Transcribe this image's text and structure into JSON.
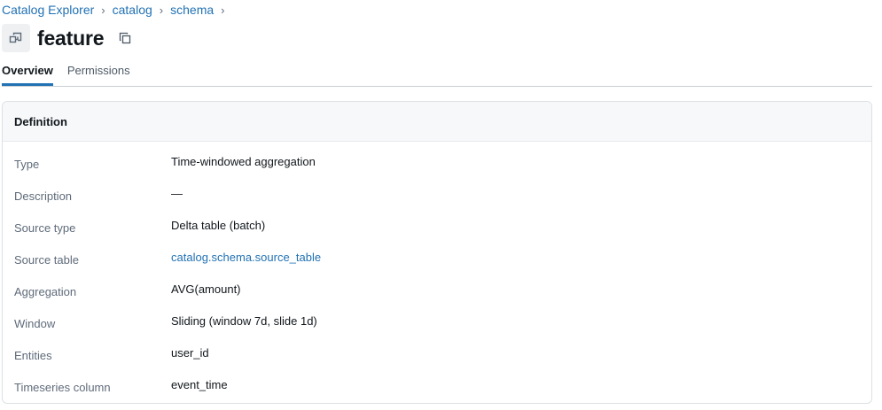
{
  "breadcrumb": {
    "items": [
      "Catalog Explorer",
      "catalog",
      "schema"
    ],
    "separator": "›"
  },
  "header": {
    "title": "feature",
    "icon": "feature-object-icon",
    "copy_icon": "copy-icon"
  },
  "tabs": [
    {
      "label": "Overview",
      "active": true
    },
    {
      "label": "Permissions",
      "active": false
    }
  ],
  "definition": {
    "title": "Definition",
    "rows": [
      {
        "label": "Type",
        "value": "Time-windowed aggregation"
      },
      {
        "label": "Description",
        "value": "—"
      },
      {
        "label": "Source type",
        "value": "Delta table (batch)"
      },
      {
        "label": "Source table",
        "value": "catalog.schema.source_table"
      },
      {
        "label": "Aggregation",
        "value": "AVG(amount)"
      },
      {
        "label": "Window",
        "value": "Sliding (window 7d, slide 1d)"
      },
      {
        "label": "Entities",
        "value": "user_id"
      },
      {
        "label": "Timeseries column",
        "value": "event_time"
      }
    ]
  },
  "colors": {
    "link": "#2272b4",
    "tab_indicator": "#2272b4",
    "muted_label": "#5f6b7a"
  }
}
